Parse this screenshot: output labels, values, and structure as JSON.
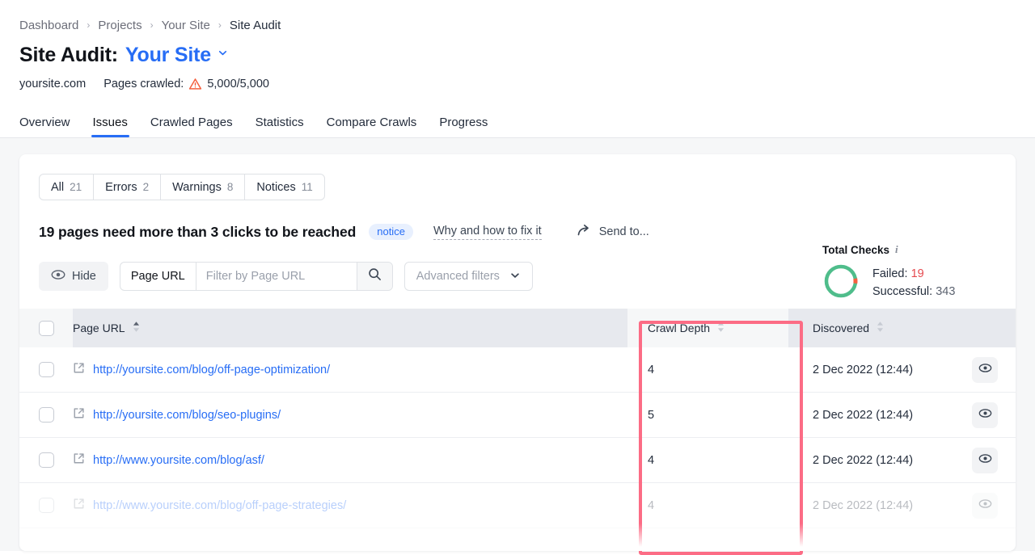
{
  "breadcrumb": {
    "items": [
      {
        "label": "Dashboard"
      },
      {
        "label": "Projects"
      },
      {
        "label": "Your Site"
      },
      {
        "label": "Site Audit"
      }
    ],
    "separator": "›"
  },
  "header": {
    "title_static": "Site Audit:",
    "project_name": "Your Site",
    "caret": "⌄",
    "domain": "yoursite.com",
    "pages_crawled_label": "Pages crawled:",
    "pages_crawled_value": "5,000/5,000",
    "warning_icon": "warning-triangle-icon"
  },
  "tabs": [
    {
      "label": "Overview",
      "active": false
    },
    {
      "label": "Issues",
      "active": true
    },
    {
      "label": "Crawled Pages",
      "active": false
    },
    {
      "label": "Statistics",
      "active": false
    },
    {
      "label": "Compare Crawls",
      "active": false
    },
    {
      "label": "Progress",
      "active": false
    }
  ],
  "segmented": [
    {
      "label": "All",
      "count": "21"
    },
    {
      "label": "Errors",
      "count": "2"
    },
    {
      "label": "Warnings",
      "count": "8"
    },
    {
      "label": "Notices",
      "count": "11"
    }
  ],
  "issue": {
    "title": "19 pages need more than 3 clicks to be reached",
    "badge": "notice",
    "fix_link": "Why and how to fix it",
    "send_to": "Send to...",
    "send_icon": "share-arrow-icon"
  },
  "checks": {
    "heading": "Total Checks",
    "info_icon": "info-icon",
    "failed_label": "Failed:",
    "failed_value": "19",
    "successful_label": "Successful:",
    "successful_value": "343",
    "donut": {
      "failed": 19,
      "successful": 343,
      "failed_color": "#f4603f",
      "successful_color": "#4fbd8b"
    }
  },
  "filters": {
    "hide_label": "Hide",
    "hide_icon": "eye-icon",
    "url_scope_label": "Page URL",
    "url_placeholder": "Filter by Page URL",
    "url_value": "",
    "search_icon": "search-icon",
    "advanced_label": "Advanced filters",
    "advanced_caret": "⌄"
  },
  "table": {
    "columns": [
      {
        "label": "Page URL",
        "sortable": true
      },
      {
        "label": "Crawl Depth",
        "sortable": true
      },
      {
        "label": "Discovered",
        "sortable": true
      }
    ],
    "rows": [
      {
        "url": "http://yoursite.com/blog/off-page-optimization/",
        "crawl_depth": "4",
        "discovered": "2 Dec 2022 (12:44)",
        "faded": false
      },
      {
        "url": "http://yoursite.com/blog/seo-plugins/",
        "crawl_depth": "5",
        "discovered": "2 Dec 2022 (12:44)",
        "faded": false
      },
      {
        "url": "http://www.yoursite.com/blog/asf/",
        "crawl_depth": "4",
        "discovered": "2 Dec 2022 (12:44)",
        "faded": false
      },
      {
        "url": "http://www.yoursite.com/blog/off-page-strategies/",
        "crawl_depth": "4",
        "discovered": "2 Dec 2022 (12:44)",
        "faded": true
      }
    ],
    "row_icons": {
      "external": "external-link-icon",
      "view": "eye-icon"
    }
  },
  "annotation": {
    "highlight_color": "#fc6c85",
    "target_column": "Crawl Depth"
  }
}
